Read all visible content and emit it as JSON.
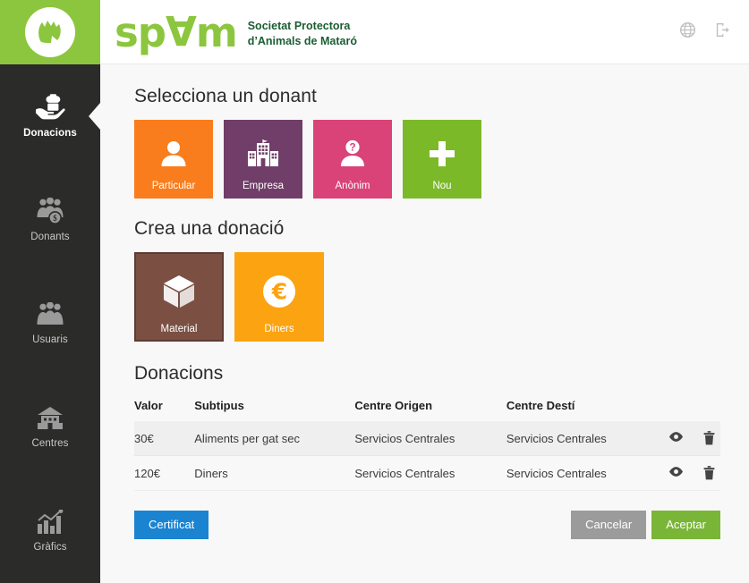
{
  "header": {
    "logo_icon": "dog-head-icon",
    "brand_part1": "sp",
    "brand_inverted_a": "A",
    "brand_part2": "m",
    "brand_subtitle": "Societat Protectora\nd’Animals de Mataró",
    "language_icon": "globe-icon",
    "logout_icon": "logout-icon",
    "brand_color": "#8cc63e",
    "subtitle_color": "#1b5e33"
  },
  "sidebar": {
    "background": "#2b2b2a",
    "items": [
      {
        "label": "Donacions",
        "icon": "hand-money-icon",
        "active": true
      },
      {
        "label": "Donants",
        "icon": "people-money-icon",
        "active": false
      },
      {
        "label": "Usuaris",
        "icon": "people-icon",
        "active": false
      },
      {
        "label": "Centres",
        "icon": "building-icon",
        "active": false
      },
      {
        "label": "Gràfics",
        "icon": "bar-chart-icon",
        "active": false
      }
    ]
  },
  "main": {
    "donor_section": {
      "title": "Selecciona un donant",
      "tiles": [
        {
          "label": "Particular",
          "icon": "person-icon",
          "color": "#f97d1c"
        },
        {
          "label": "Empresa",
          "icon": "company-icon",
          "color": "#703e68"
        },
        {
          "label": "Anònim",
          "icon": "anonymous-icon",
          "color": "#d94377"
        },
        {
          "label": "Nou",
          "icon": "plus-icon",
          "color": "#7cb929"
        }
      ]
    },
    "donation_section": {
      "title": "Crea una donació",
      "tiles": [
        {
          "label": "Material",
          "icon": "box-icon",
          "color": "#7b5043",
          "selected": true
        },
        {
          "label": "Diners",
          "icon": "euro-icon",
          "color": "#fca311",
          "selected": false
        }
      ]
    },
    "table_section": {
      "title": "Donacions",
      "columns": [
        "Valor",
        "Subtipus",
        "Centre Origen",
        "Centre Destí",
        ""
      ],
      "rows": [
        {
          "valor": "30€",
          "subtipus": "Aliments per gat sec",
          "origen": "Servicios Centrales",
          "desti": "Servicios Centrales",
          "view_icon": "eye-icon",
          "delete_icon": "trash-icon"
        },
        {
          "valor": "120€",
          "subtipus": "Diners",
          "origen": "Servicios Centrales",
          "desti": "Servicios Centrales",
          "view_icon": "eye-icon",
          "delete_icon": "trash-icon"
        }
      ]
    },
    "buttons": {
      "certificat": "Certificat",
      "cancelar": "Cancelar",
      "aceptar": "Aceptar",
      "certificat_color": "#1a84d0",
      "cancelar_color": "#9b9b9b",
      "aceptar_color": "#79b536"
    }
  }
}
